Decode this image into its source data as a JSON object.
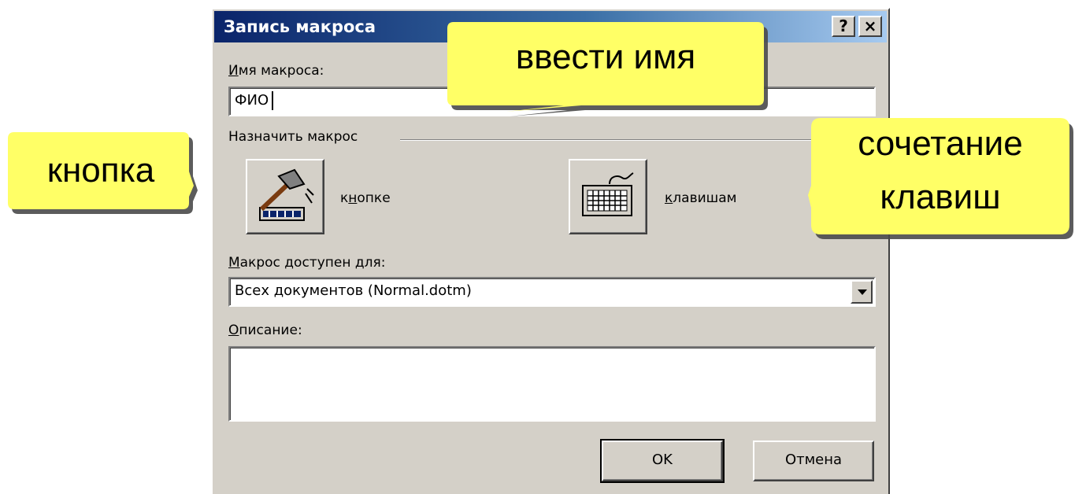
{
  "dialog": {
    "title": "Запись макроса",
    "help_glyph": "?",
    "close_glyph": "×",
    "macro_name_label_u": "И",
    "macro_name_label_rest": "мя макроса:",
    "macro_name_value": "ФИО",
    "assign_group_label": "Назначить макрос",
    "button_option_pre": "к",
    "button_option_u": "н",
    "button_option_post": "опке",
    "keys_option_u": "к",
    "keys_option_rest": "лавишам",
    "available_label_u": "М",
    "available_label_rest": "акрос доступен для:",
    "available_value": "Всех документов (Normal.dotm)",
    "description_label_u": "О",
    "description_label_rest": "писание:",
    "description_value": "",
    "ok_label": "OK",
    "cancel_label": "Отмена",
    "button_icon": "hammer-button-icon",
    "keyboard_icon": "keyboard-icon"
  },
  "callouts": {
    "enter_name": "ввести имя",
    "button": "кнопка",
    "combo_line1": "сочетание",
    "combo_line2": "клавиш"
  },
  "colors": {
    "callout_fill": "#ffff66",
    "dialog_face": "#d4d0c8",
    "title_gradient_start": "#0a246a"
  }
}
